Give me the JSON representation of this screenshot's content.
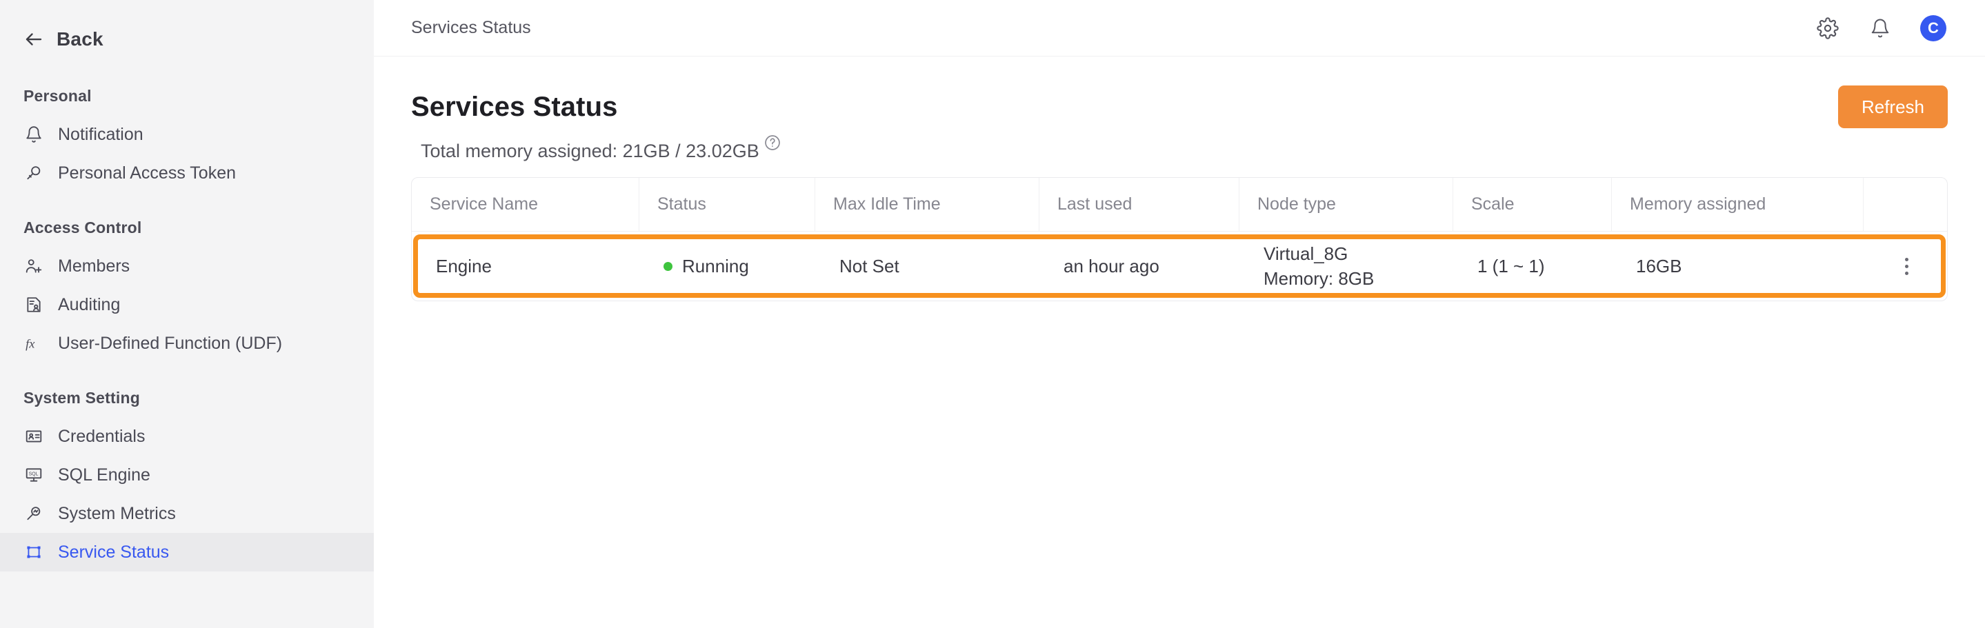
{
  "sidebar": {
    "back_label": "Back",
    "sections": [
      {
        "title": "Personal",
        "items": [
          {
            "label": "Notification",
            "icon": "bell-icon",
            "active": false
          },
          {
            "label": "Personal Access Token",
            "icon": "key-search-icon",
            "active": false
          }
        ]
      },
      {
        "title": "Access Control",
        "items": [
          {
            "label": "Members",
            "icon": "members-add-icon",
            "active": false
          },
          {
            "label": "Auditing",
            "icon": "audit-document-icon",
            "active": false
          },
          {
            "label": "User-Defined Function (UDF)",
            "icon": "fx-icon",
            "active": false
          }
        ]
      },
      {
        "title": "System Setting",
        "items": [
          {
            "label": "Credentials",
            "icon": "id-card-icon",
            "active": false
          },
          {
            "label": "SQL Engine",
            "icon": "sql-monitor-icon",
            "active": false
          },
          {
            "label": "System Metrics",
            "icon": "metrics-magnifier-icon",
            "active": false
          },
          {
            "label": "Service Status",
            "icon": "crop-frame-icon",
            "active": true
          }
        ]
      }
    ]
  },
  "topbar": {
    "breadcrumb": "Services Status",
    "icons": [
      {
        "name": "gear-icon"
      },
      {
        "name": "bell-icon"
      }
    ],
    "avatar_initial": "C"
  },
  "page": {
    "title": "Services Status",
    "refresh_label": "Refresh",
    "memory_summary": "Total memory assigned: 21GB / 23.02GB",
    "help_glyph": "?"
  },
  "colors": {
    "accent_orange": "#f28c38",
    "highlight_orange": "#f7911e",
    "active_blue": "#3858f0",
    "status_green": "#3ec43e"
  },
  "table": {
    "columns": [
      "Service Name",
      "Status",
      "Max Idle Time",
      "Last used",
      "Node type",
      "Scale",
      "Memory assigned",
      ""
    ],
    "rows": [
      {
        "service_name": "Engine",
        "status": "Running",
        "max_idle_time": "Not Set",
        "last_used": "an hour ago",
        "node_type": "Virtual_8G",
        "node_memory": "Memory: 8GB",
        "scale": "1 (1 ~ 1)",
        "memory_assigned": "16GB",
        "highlighted": true
      }
    ]
  }
}
